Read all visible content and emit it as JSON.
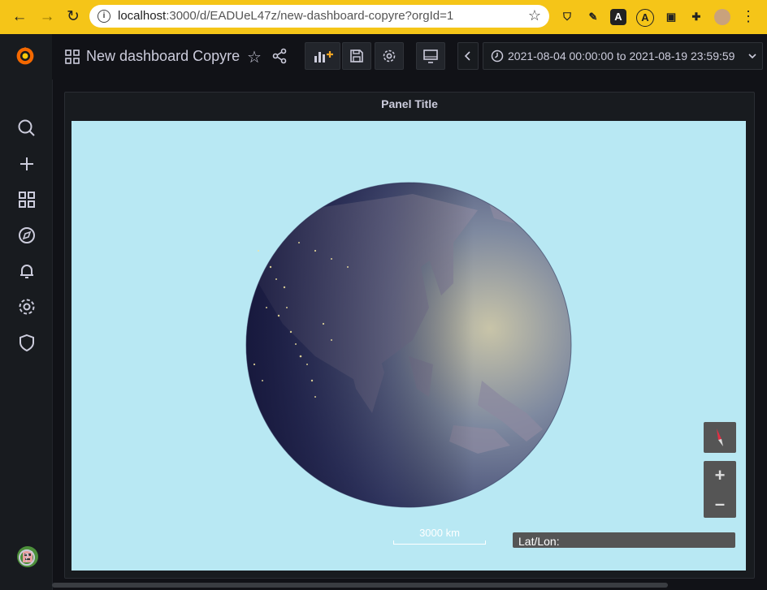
{
  "browser": {
    "url_host": "localhost",
    "url_path": ":3000/d/EADUeL47z/new-dashboard-copyre?orgId=1"
  },
  "header": {
    "dashboard_title": "New dashboard Copyre",
    "time_range": "2021-08-04 00:00:00 to 2021-08-19 23:59:59"
  },
  "panel": {
    "title": "Panel Title",
    "scale_label": "3000 km",
    "latlon_label": "Lat/Lon:",
    "zoom_in": "+",
    "zoom_out": "–"
  },
  "colors": {
    "map_background": "#b8e8f3",
    "chrome": "#f5c518",
    "sidebar": "#181b1f"
  },
  "icons": {
    "sidebar": [
      "search-icon",
      "plus-icon",
      "dashboards-icon",
      "explore-icon",
      "alerting-icon",
      "settings-icon",
      "shield-icon",
      "help-icon"
    ]
  }
}
